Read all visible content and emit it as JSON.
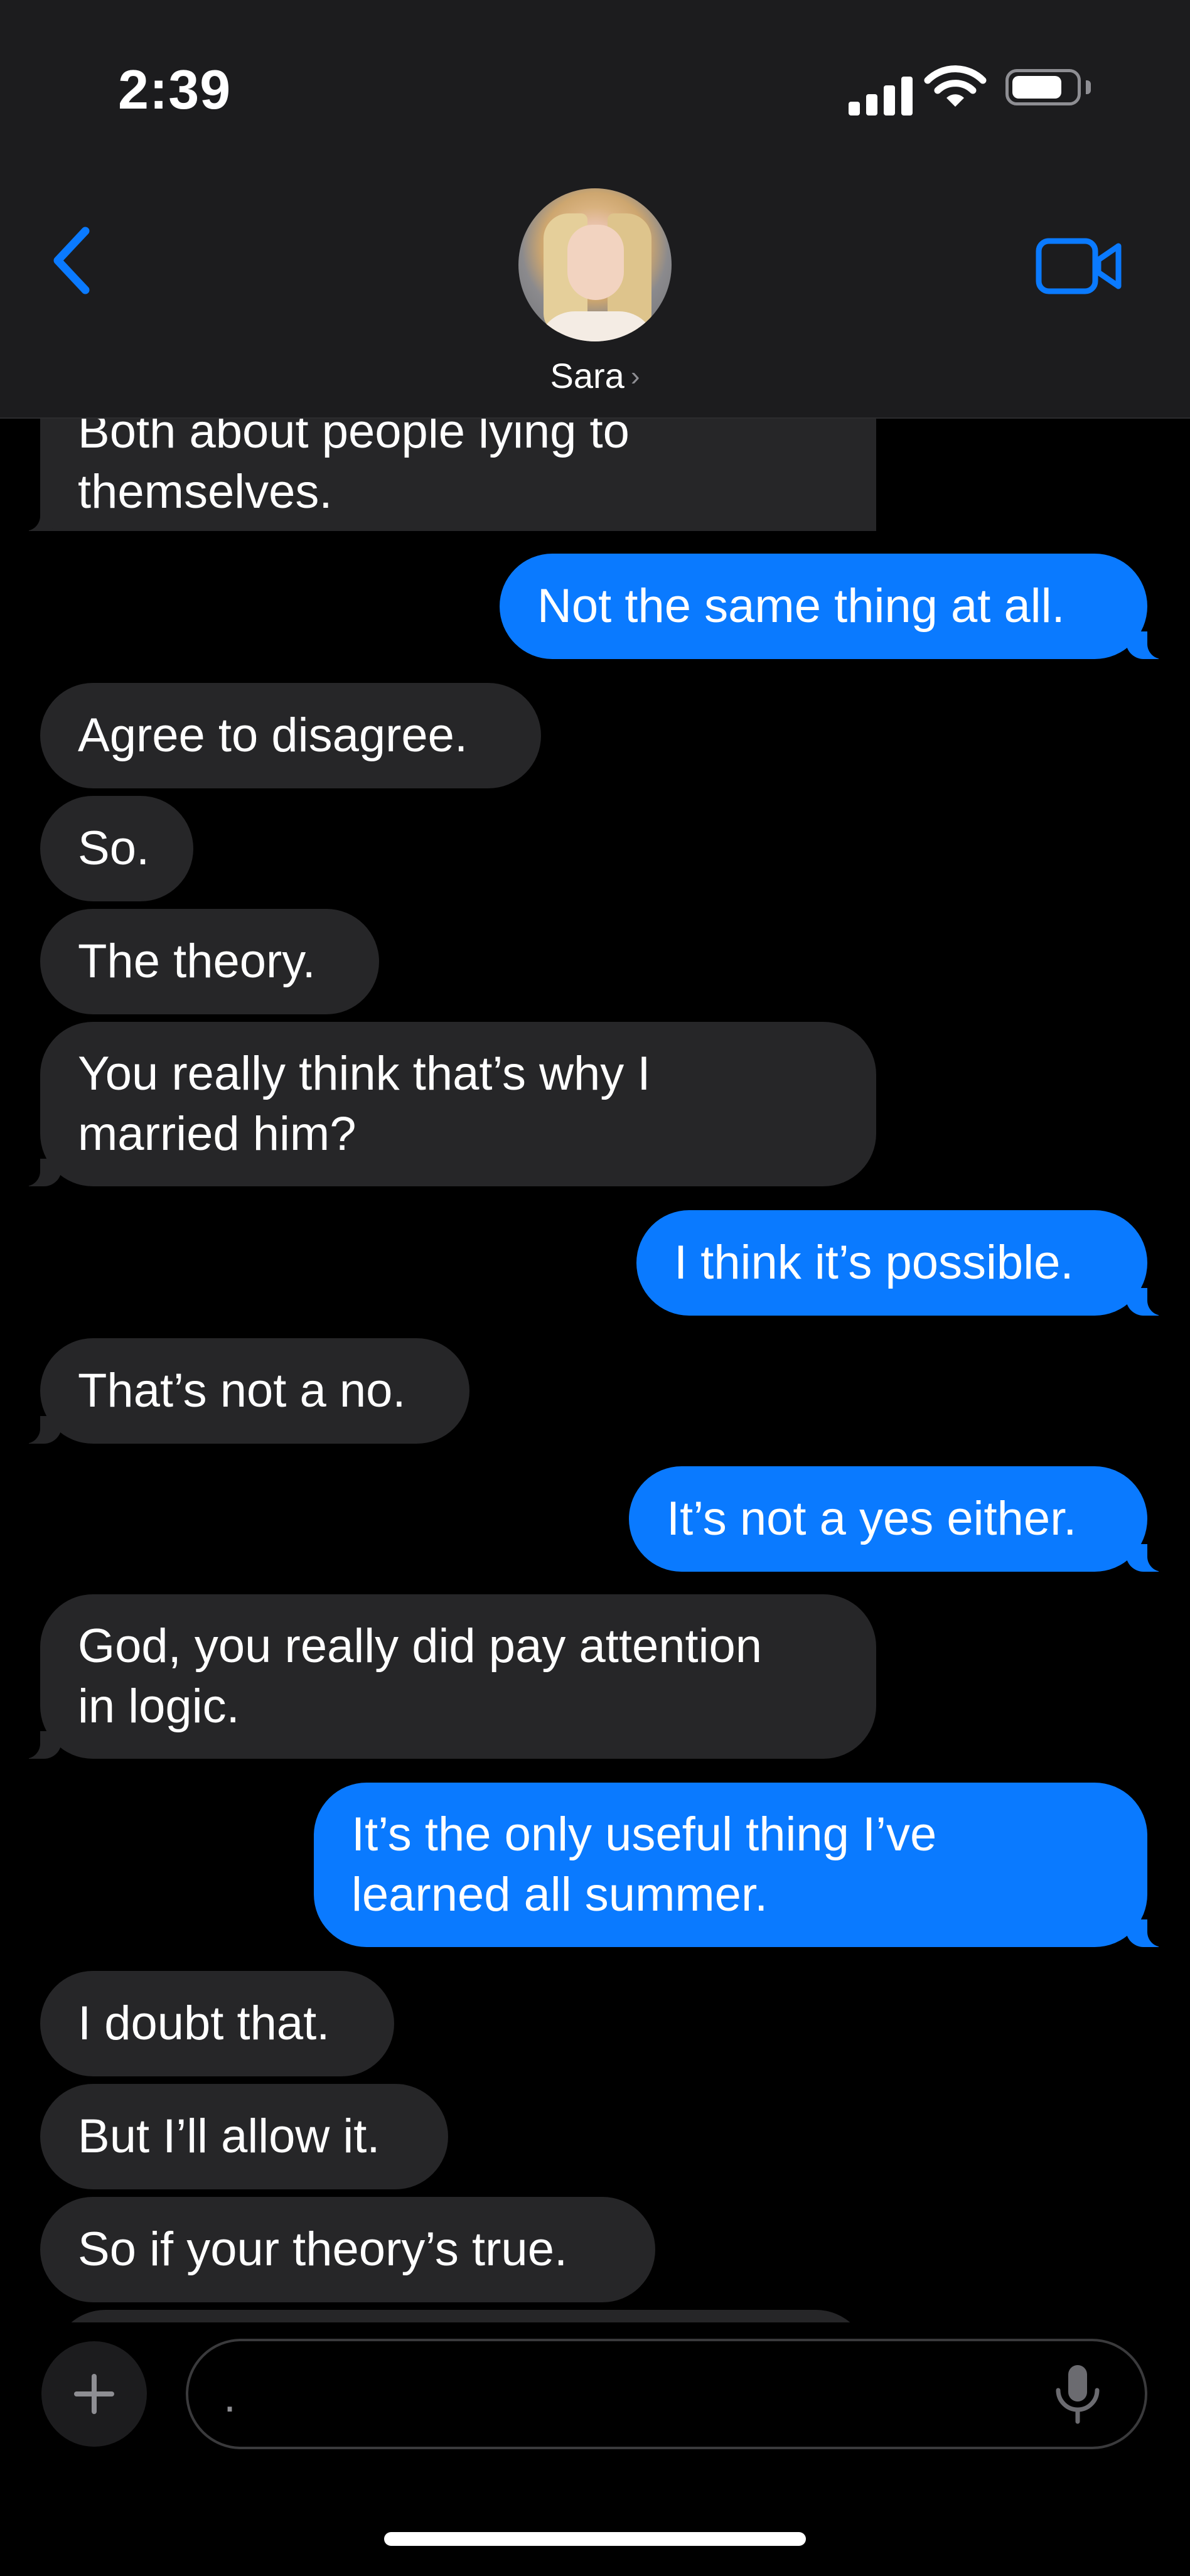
{
  "status_bar": {
    "time": "2:39",
    "battery_level": 0.8
  },
  "header": {
    "contact_name": "Sara",
    "chevron": "›",
    "back_icon": "chevron-left-icon",
    "video_icon": "video-camera-icon"
  },
  "colors": {
    "accent": "#0a7aff",
    "incoming_bubble": "#262628",
    "background": "#000000",
    "header": "#1c1c1e"
  },
  "messages": [
    {
      "dir": "in",
      "lines": [
        "Both about people lying to",
        "themselves."
      ]
    },
    {
      "dir": "out",
      "lines": [
        "Not the same thing at all."
      ]
    },
    {
      "dir": "in",
      "lines": [
        "Agree to disagree."
      ]
    },
    {
      "dir": "in",
      "lines": [
        "So."
      ]
    },
    {
      "dir": "in",
      "lines": [
        "The theory."
      ]
    },
    {
      "dir": "in",
      "lines": [
        "You really think that’s why I",
        "married him?"
      ]
    },
    {
      "dir": "out",
      "lines": [
        "I think it’s possible."
      ]
    },
    {
      "dir": "in",
      "lines": [
        "That’s not a no."
      ]
    },
    {
      "dir": "out",
      "lines": [
        "It’s not a yes either."
      ]
    },
    {
      "dir": "in",
      "lines": [
        "God, you really did pay attention",
        "in logic."
      ]
    },
    {
      "dir": "out",
      "lines": [
        "It’s the only useful thing I’ve",
        "learned all summer."
      ]
    },
    {
      "dir": "in",
      "lines": [
        "I doubt that."
      ]
    },
    {
      "dir": "in",
      "lines": [
        "But I’ll allow it."
      ]
    },
    {
      "dir": "in",
      "lines": [
        "So if your theory’s true."
      ]
    }
  ],
  "composer": {
    "text": ".",
    "plus_icon": "plus-icon",
    "mic_icon": "microphone-icon"
  }
}
